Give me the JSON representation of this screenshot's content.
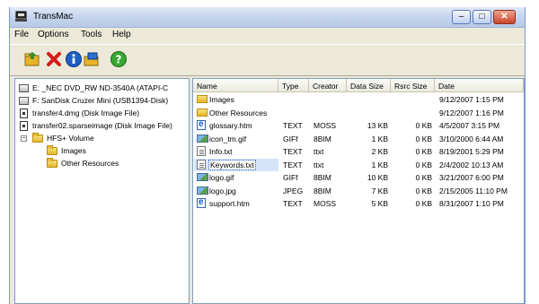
{
  "window": {
    "title": "TransMac"
  },
  "titlebar": {
    "minimize_glyph": "–",
    "maximize_glyph": "□",
    "close_glyph": "✕"
  },
  "menu": [
    "File",
    "Options",
    "Tools",
    "Help"
  ],
  "toolbar": {
    "buttons": [
      {
        "icon": "open-folder-icon"
      },
      {
        "icon": "delete-x-icon"
      },
      {
        "icon": "info-icon"
      },
      {
        "icon": "copy-folder-icon"
      },
      {
        "icon": "help-icon"
      }
    ]
  },
  "tree": [
    {
      "label": "E: _NEC DVD_RW ND-3540A (ATAPI-C",
      "icon": "drive-icon"
    },
    {
      "label": "F: SanDisk Cruzer Mini (USB1394-Disk)",
      "icon": "drive-icon"
    },
    {
      "label": "transfer4.dmg (Disk Image File)",
      "icon": "disk-image-icon"
    },
    {
      "label": "transfer02.sparseimage (Disk Image File)",
      "icon": "disk-image-icon"
    },
    {
      "label": "HFS+ Volume",
      "icon": "folder-icon",
      "expander": "−"
    },
    {
      "label": "Images",
      "icon": "folder-icon"
    },
    {
      "label": "Other Resources",
      "icon": "folder-icon"
    }
  ],
  "list": {
    "columns": [
      "Name",
      "Type",
      "Creator",
      "Data Size",
      "Rsrc Size",
      "Date"
    ],
    "rows": [
      {
        "name": "Images",
        "type": "",
        "creator": "",
        "data": "",
        "rsrc": "",
        "date": "9/12/2007 1:15 PM",
        "icon": "folder"
      },
      {
        "name": "Other Resources",
        "type": "",
        "creator": "",
        "data": "",
        "rsrc": "",
        "date": "9/12/2007 1:16 PM",
        "icon": "folder"
      },
      {
        "name": "glossary.htm",
        "type": "TEXT",
        "creator": "MOSS",
        "data": "13 KB",
        "rsrc": "0 KB",
        "date": "4/5/2007 3:15 PM",
        "icon": "htm"
      },
      {
        "name": "icon_tm.gif",
        "type": "GIFf",
        "creator": "8BIM",
        "data": "1 KB",
        "rsrc": "0 KB",
        "date": "3/10/2000 6:44 AM",
        "icon": "gif"
      },
      {
        "name": "Info.txt",
        "type": "TEXT",
        "creator": "ttxt",
        "data": "2 KB",
        "rsrc": "0 KB",
        "date": "8/19/2001 5:29 PM",
        "icon": "txt"
      },
      {
        "name": "Keywords.txt",
        "type": "TEXT",
        "creator": "ttxt",
        "data": "1 KB",
        "rsrc": "0 KB",
        "date": "2/4/2002 10:13 AM",
        "icon": "txt",
        "selected": true
      },
      {
        "name": "logo.gif",
        "type": "GIFf",
        "creator": "8BIM",
        "data": "10 KB",
        "rsrc": "0 KB",
        "date": "3/21/2007 6:00 PM",
        "icon": "gif"
      },
      {
        "name": "logo.jpg",
        "type": "JPEG",
        "creator": "8BIM",
        "data": "7 KB",
        "rsrc": "0 KB",
        "date": "2/15/2005 11:10 PM",
        "icon": "gif"
      },
      {
        "name": "support.htm",
        "type": "TEXT",
        "creator": "MOSS",
        "data": "5 KB",
        "rsrc": "0 KB",
        "date": "8/31/2007 1:10 PM",
        "icon": "htm"
      }
    ]
  }
}
